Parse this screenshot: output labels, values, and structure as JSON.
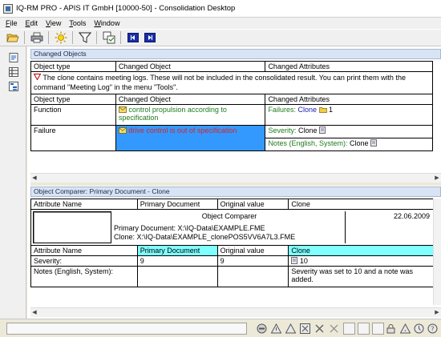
{
  "window": {
    "title": "IQ-RM PRO - APIS IT GmbH [10000-50] - Consolidation Desktop"
  },
  "menu": [
    {
      "label": "File",
      "key": "F",
      "rest": "ile"
    },
    {
      "label": "Edit",
      "key": "E",
      "rest": "dit"
    },
    {
      "label": "View",
      "key": "V",
      "rest": "iew"
    },
    {
      "label": "Tools",
      "key": "T",
      "rest": "ools"
    },
    {
      "label": "Window",
      "key": "W",
      "rest": "indow"
    }
  ],
  "toolbar": {
    "icons": [
      "open-folder-icon",
      "print-icon",
      "sun-settings-icon",
      "filter-icon",
      "compare-icon",
      "navigate-back-icon",
      "navigate-forward-icon"
    ]
  },
  "changed_objects": {
    "header": "Changed Objects",
    "columns": [
      "Object type",
      "Changed Object",
      "Changed Attributes"
    ],
    "notice": "The clone contains meeting logs. These will not be included in the consolidated result. You can print them with the command \"Meeting Log\" in the menu \"Tools\".",
    "sub_columns": [
      "Object type",
      "Changed Object",
      "Changed Attributes"
    ],
    "rows": [
      {
        "type": "Function",
        "object": "control propulsion according to specification",
        "attr_label": "Failures:",
        "attr_value": "Clone",
        "attr_count": "1"
      },
      {
        "type": "Failure",
        "object": "drive control is out of specification",
        "attr1_label": "Severity:",
        "attr1_value": "Clone",
        "attr2_label": "Notes (English, System):",
        "attr2_value": "Clone"
      }
    ]
  },
  "comparer": {
    "header": "Object Comparer: Primary Document - Clone",
    "columns": [
      "Attribute Name",
      "Primary Document",
      "Original value",
      "Clone"
    ],
    "box_title": "Object Comparer",
    "box_date": "22.06.2009",
    "primary_line": "Primary Document: X:\\IQ-Data\\EXAMPLE.FME",
    "clone_line": "Clone: X:\\IQ-Data\\EXAMPLE_clonePOS5VV6A7L3.FME",
    "sub_columns": [
      "Attribute Name",
      "Primary Document",
      "Original value",
      "Clone"
    ],
    "rows": [
      {
        "name": "Severity:",
        "primary": "9",
        "original": "9",
        "clone": "10"
      },
      {
        "name": "Notes (English, System):",
        "primary": "",
        "original": "",
        "clone": "Severity was set to 10 and a note was added."
      }
    ]
  },
  "colors": {
    "header_cyan": "#80ffff",
    "selected_blue": "#3399ff",
    "green_text": "#1f7a1f",
    "red_text": "#e02020"
  }
}
